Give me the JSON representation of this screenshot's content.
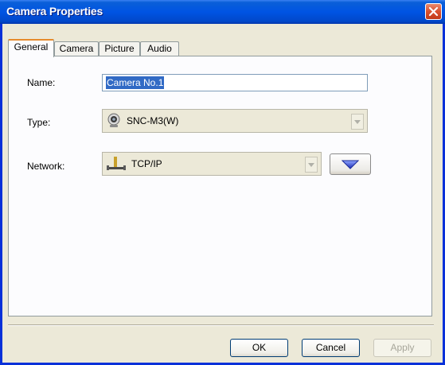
{
  "window": {
    "title": "Camera Properties"
  },
  "tabs": [
    {
      "label": "General",
      "active": true
    },
    {
      "label": "Camera",
      "active": false
    },
    {
      "label": "Picture",
      "active": false
    },
    {
      "label": "Audio",
      "active": false
    }
  ],
  "general": {
    "name_label": "Name:",
    "name_value": "Camera No.1",
    "type_label": "Type:",
    "type_value": "SNC-M3(W)",
    "type_icon": "webcam-icon",
    "network_label": "Network:",
    "network_value": "TCP/IP",
    "network_icon": "network-icon"
  },
  "buttons": {
    "ok": "OK",
    "cancel": "Cancel",
    "apply": "Apply"
  },
  "colors": {
    "titlebar": "#0054e3",
    "close": "#d9502e",
    "selection": "#316ac5",
    "dropdown_arrow": "#2a2fbf"
  }
}
